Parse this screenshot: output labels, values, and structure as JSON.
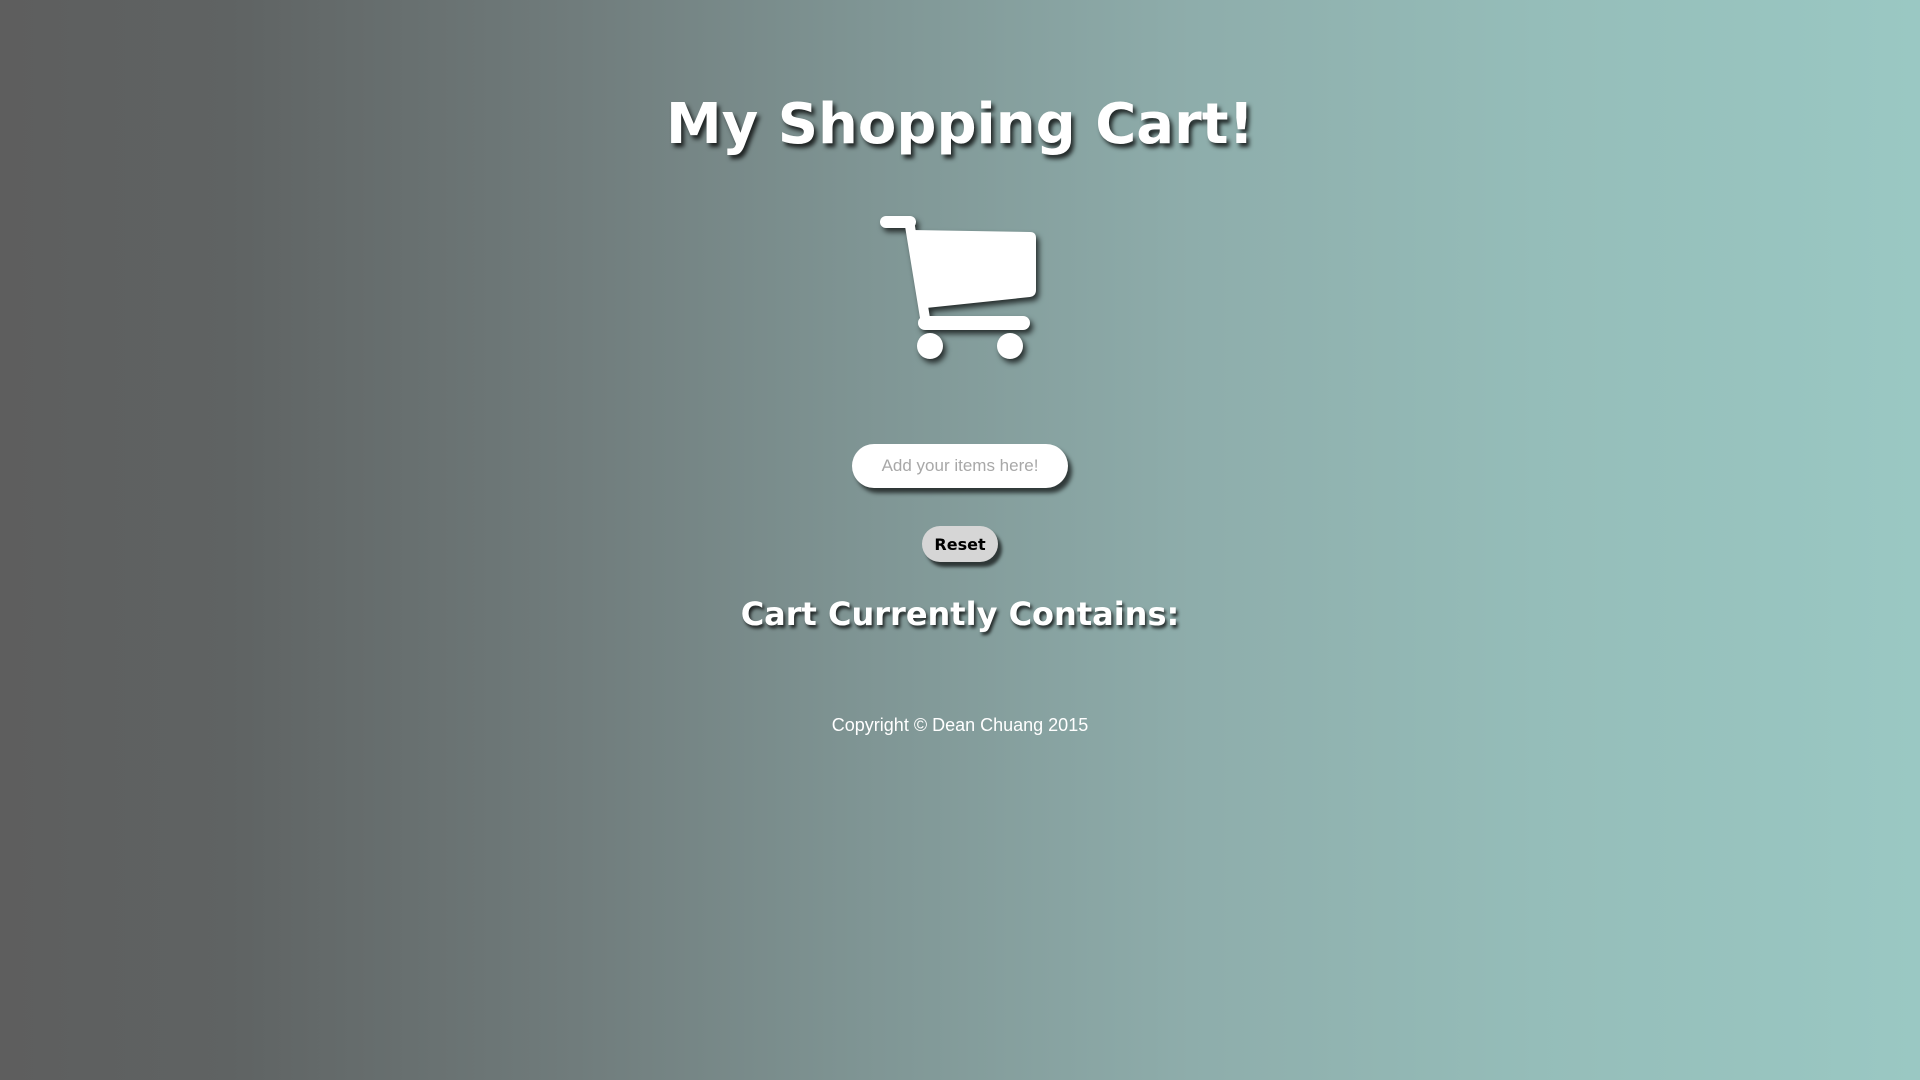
{
  "header": {
    "title": "My Shopping Cart!"
  },
  "icons": {
    "cart": "shopping-cart-icon"
  },
  "form": {
    "item_input_value": "",
    "item_input_placeholder": "Add your items here!",
    "reset_label": "Reset"
  },
  "cart": {
    "heading": "Cart Currently Contains:",
    "items": []
  },
  "footer": {
    "copyright": "Copyright © Dean Chuang 2015"
  },
  "colors": {
    "background_left": "#5e5e5e",
    "background_right": "#9ac8c3",
    "text": "#ffffff",
    "button_bg": "#d6d6d6"
  }
}
